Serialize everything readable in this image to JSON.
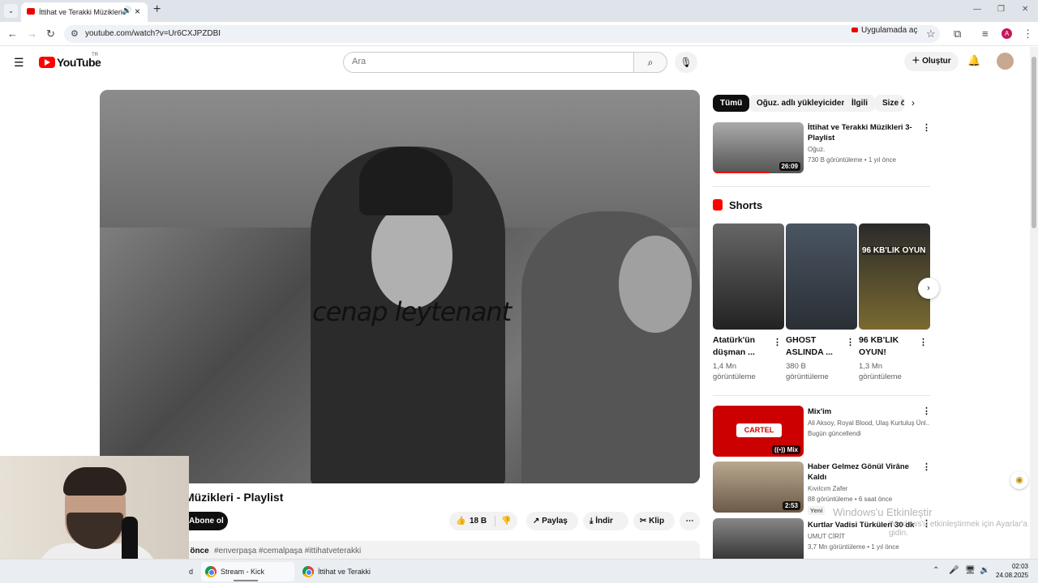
{
  "browser": {
    "tab_title": "İttihat ve Terakki Müzikleri",
    "url": "youtube.com/watch?v=Ur6CXJPZDBI",
    "open_in_app": "Uygulamada aç",
    "profile_initial": "A"
  },
  "yt": {
    "country_code": "TR",
    "logo_text": "YouTube",
    "search_placeholder": "Ara",
    "create_label": "Oluştur"
  },
  "video": {
    "overlay_text": "cenap leytenant",
    "title": "Müzikleri - Playlist",
    "subscribe_label": "Abone ol",
    "likes": "18 B",
    "share_label": "Paylaş",
    "download_label": "İndir",
    "clip_label": "Klip",
    "desc_time": "ıl önce",
    "hashtags": "#enverpaşa #cemalpaşa #ittihatveterakki"
  },
  "chips": [
    "Tümü",
    "Oğuz. adlı yükleyiciden",
    "İlgili",
    "Size ö"
  ],
  "recs": [
    {
      "title": "İttihat ve Terakki Müzikleri 3- Playlist",
      "channel": "Oğuz.",
      "meta": "730 B görüntüleme • 1 yıl önce",
      "duration": "26:09"
    },
    {
      "title": "Mix'im",
      "channel": "Ali Aksoy, Royal Blood, Ulaş Kurtuluş Ünl...",
      "meta": "Bugün güncellendi",
      "duration": "Mix",
      "thumb_text": "CARTEL"
    },
    {
      "title": "Haber Gelmez Gönül Virâne Kaldı",
      "channel": "Kıvılcım Zafer",
      "meta": "88 görüntüleme • 6 saat önce",
      "badge": "Yeni",
      "duration": "2:53"
    },
    {
      "title": "Kurtlar Vadisi Türküleri 30 dk",
      "channel": "UMUT CİRİT",
      "meta": "3,7 Mn görüntüleme • 1 yıl önce"
    }
  ],
  "shorts": {
    "heading": "Shorts",
    "items": [
      {
        "title": "Atatürk'ün düşman ...",
        "views": "1,4 Mn görüntüleme"
      },
      {
        "title": "GHOST ASLINDA ...",
        "views": "380 B görüntüleme"
      },
      {
        "title": "96 KB'LIK OYUN!",
        "views": "1,3 Mn görüntüleme",
        "thumb_text": "96 KB'LIK OYUN"
      }
    ]
  },
  "watermark": {
    "line1": "Windows'u Etkinleştir",
    "line2": "Windows'u etkinleştirmek için Ayarlar'a gidin."
  },
  "taskbar": {
    "item0": "d",
    "item1": "Stream - Kick Dashboard",
    "item2": "İttihat ve Terakki Müzikl",
    "time": "02:03",
    "date": "24.08.2025"
  }
}
